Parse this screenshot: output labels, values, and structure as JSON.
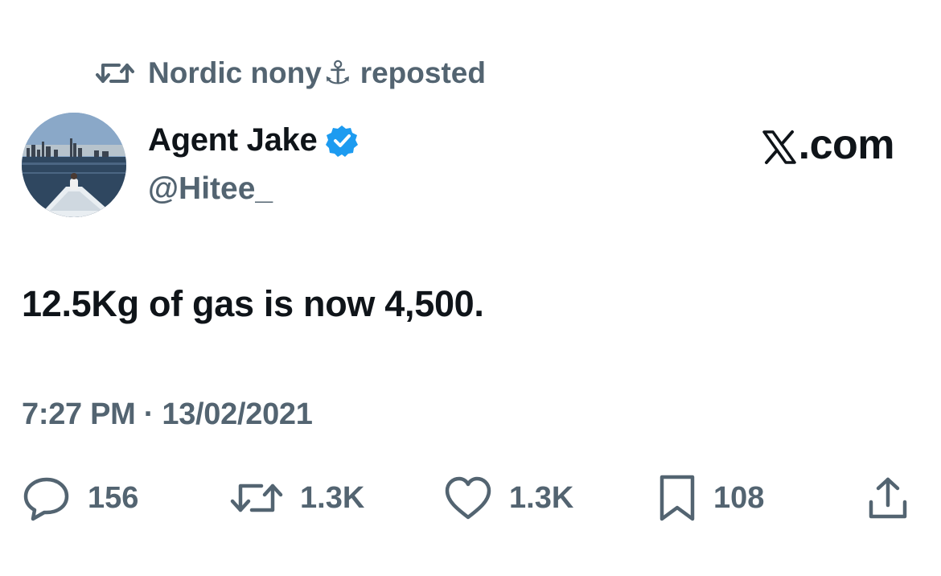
{
  "social_context": {
    "icon": "repost-icon",
    "user_name": "Nordic nony",
    "emoji": "⚓",
    "action": "reposted"
  },
  "author": {
    "name": "Agent Jake",
    "handle": "@Hitee_",
    "verified": true,
    "verified_color": "#1d9bf0"
  },
  "brand": {
    "text": ".com",
    "logo": "x-logo-icon"
  },
  "tweet": {
    "text": "12.5Kg of gas is now 4,500.",
    "timestamp": "7:27 PM · 13/02/2021"
  },
  "actions": {
    "replies": {
      "icon": "reply-icon",
      "count": "156"
    },
    "reposts": {
      "icon": "repost-icon",
      "count": "1.3K"
    },
    "likes": {
      "icon": "heart-icon",
      "count": "1.3K"
    },
    "bookmarks": {
      "icon": "bookmark-icon",
      "count": "108"
    },
    "share": {
      "icon": "share-icon"
    }
  },
  "colors": {
    "text_primary": "#0f1419",
    "text_secondary": "#536471",
    "background": "#ffffff"
  }
}
